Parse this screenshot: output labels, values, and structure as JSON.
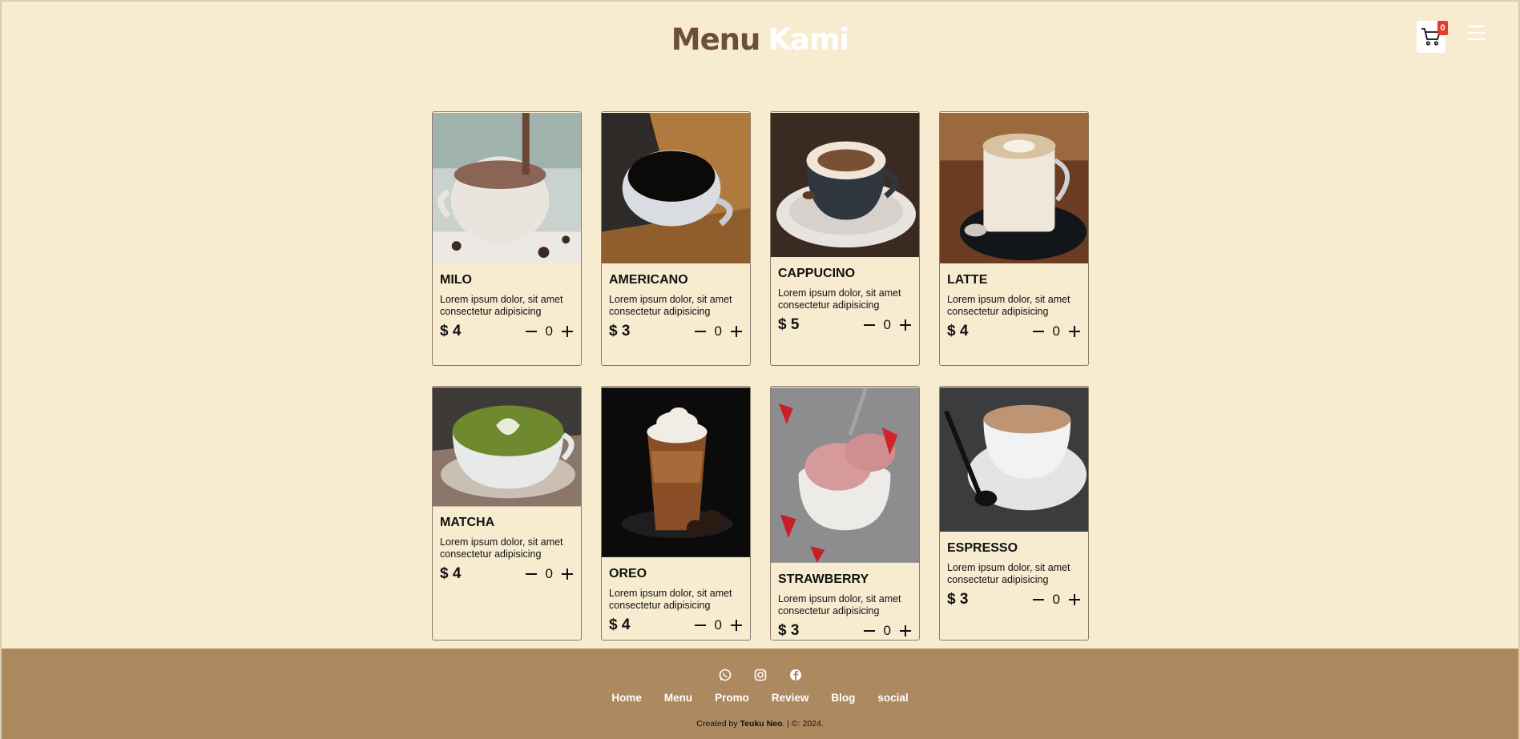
{
  "header": {
    "title_part1": "Menu",
    "title_part2": "Kami",
    "cart_count": "0"
  },
  "products": [
    {
      "name": "MILO",
      "desc": "Lorem ipsum dolor, sit amet consectetur adipisicing",
      "price": "$ 4",
      "qty": "0"
    },
    {
      "name": "AMERICANO",
      "desc": "Lorem ipsum dolor, sit amet consectetur adipisicing",
      "price": "$ 3",
      "qty": "0"
    },
    {
      "name": "CAPPUCINO",
      "desc": "Lorem ipsum dolor, sit amet consectetur adipisicing",
      "price": "$ 5",
      "qty": "0"
    },
    {
      "name": "LATTE",
      "desc": "Lorem ipsum dolor, sit amet consectetur adipisicing",
      "price": "$ 4",
      "qty": "0"
    },
    {
      "name": "MATCHA",
      "desc": "Lorem ipsum dolor, sit amet consectetur adipisicing",
      "price": "$ 4",
      "qty": "0"
    },
    {
      "name": "OREO",
      "desc": "Lorem ipsum dolor, sit amet consectetur adipisicing",
      "price": "$ 4",
      "qty": "0"
    },
    {
      "name": "STRAWBERRY",
      "desc": "Lorem ipsum dolor, sit amet consectetur adipisicing",
      "price": "$ 3",
      "qty": "0"
    },
    {
      "name": "ESPRESSO",
      "desc": "Lorem ipsum dolor, sit amet consectetur adipisicing",
      "price": "$ 3",
      "qty": "0"
    }
  ],
  "footer": {
    "social_icons": [
      "whatsapp-icon",
      "instagram-icon",
      "facebook-icon"
    ],
    "nav": [
      "Home",
      "Menu",
      "Promo",
      "Review",
      "Blog",
      "social"
    ],
    "credit_prefix": "Created by",
    "credit_author": "Teuku Neo",
    "credit_suffix": ". | ©: 2024."
  },
  "colors": {
    "background": "#f7ebd0",
    "title_brown": "#6f4e37",
    "footer": "#ad8960",
    "badge": "#e43b2c"
  }
}
